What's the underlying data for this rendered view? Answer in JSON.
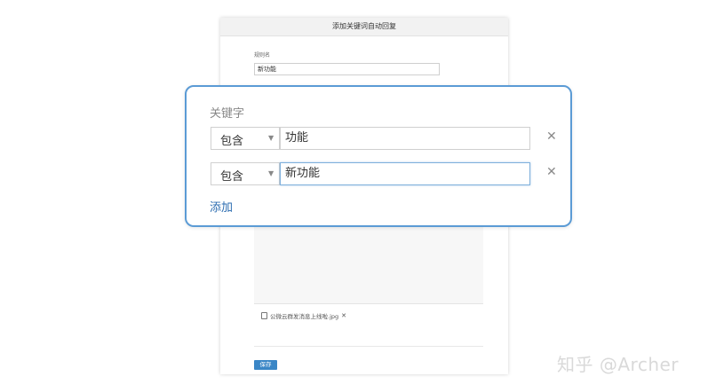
{
  "dialog": {
    "title": "添加关键词自动回复",
    "rule_name_label": "规则名",
    "rule_name_value": "新功能",
    "attachment_name": "公微云群发消息上线啦.jpg",
    "attachment_remove": "✕",
    "save_label": "保存"
  },
  "keywords": {
    "title": "关键字",
    "rows": [
      {
        "match": "包含",
        "value": "功能",
        "remove": "✕"
      },
      {
        "match": "包含",
        "value": "新功能",
        "remove": "✕"
      }
    ],
    "add_label": "添加",
    "caret": "▼"
  },
  "watermark": "知乎 @Archer",
  "colors": {
    "accent": "#5b9bd5",
    "link": "#2b6cb0",
    "save_button": "#3a86c6"
  }
}
